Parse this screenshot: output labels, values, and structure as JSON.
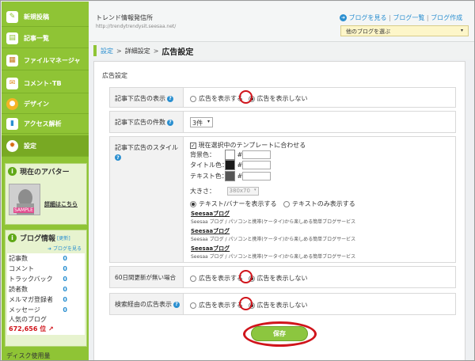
{
  "sidebar": {
    "nav": [
      {
        "label": "新規投稿",
        "icon": "pencil-icon"
      },
      {
        "label": "記事一覧",
        "icon": "document-icon"
      },
      {
        "label": "ファイルマネージャ",
        "icon": "file-icon"
      },
      {
        "label": "コメント･TB",
        "icon": "comment-icon"
      },
      {
        "label": "デザイン",
        "icon": "palette-icon"
      },
      {
        "label": "アクセス解析",
        "icon": "chart-icon"
      },
      {
        "label": "設定",
        "icon": "gear-icon"
      }
    ],
    "avatar_panel": {
      "title": "現在のアバター",
      "sample_label": "SAMPLE",
      "detail_link": "詳細はこちら"
    },
    "blog_info": {
      "title": "ブログ情報",
      "update_link": "[更新]",
      "view_blog": "ブログを見る",
      "stats": [
        {
          "label": "記事数",
          "value": "0"
        },
        {
          "label": "コメント",
          "value": "0"
        },
        {
          "label": "トラックバック",
          "value": "0"
        },
        {
          "label": "読者数",
          "value": "0"
        },
        {
          "label": "メルマガ登録者",
          "value": "0"
        },
        {
          "label": "メッセージ",
          "value": "0"
        }
      ],
      "popular_label": "人気のブログ",
      "popular_rank": "672,656 位"
    },
    "disk_usage": "ディスク使用量"
  },
  "header": {
    "blog_name": "トレンド情報発信所",
    "blog_url": "http://trendytrendysit.seesaa.net/",
    "links": {
      "view_blog": "ブログを見る",
      "blog_list": "ブログ一覧",
      "create_blog": "ブログ作成",
      "sep": "|"
    },
    "other_blog_select": "他のブログを選ぶ"
  },
  "breadcrumb": {
    "settings": "設定",
    "detail": "詳細設定",
    "current": "広告設定",
    "sep": ">"
  },
  "form": {
    "section_title": "広告設定",
    "show_ads": "広告を表示する",
    "hide_ads": "広告を表示しない",
    "rows": {
      "under_article": {
        "label": "記事下広告の表示"
      },
      "count": {
        "label": "記事下広告の件数",
        "value": "3件"
      },
      "style": {
        "label": "記事下広告のスタイル",
        "match_template": "現在選択中のテンプレートに合わせる",
        "bg_color": "背景色：",
        "title_color": "タイトル色：",
        "text_color": "テキスト色：",
        "hash": "#",
        "size_label": "大きさ：",
        "size_value": "380x70",
        "text_banner": "テキスト/バナーを表示する",
        "text_only": "テキストのみ表示する",
        "samples": [
          {
            "title": "Seesaaブログ",
            "desc": "Seesaa ブログ / パソコンと携帯(ケータイ)から楽しめる簡単ブログサービス"
          },
          {
            "title": "Seesaaブログ",
            "desc": "Seesaa ブログ / パソコンと携帯(ケータイ)から楽しめる簡単ブログサービス"
          },
          {
            "title": "Seesaaブログ",
            "desc": "Seesaa ブログ / パソコンと携帯(ケータイ)から楽しめる簡単ブログサービス"
          }
        ]
      },
      "no_update": {
        "label": "60日間更新が無い場合"
      },
      "search": {
        "label": "検索経由の広告表示"
      }
    },
    "save": "保存"
  },
  "colors": {
    "sidebar_green": "#8fc435",
    "link_blue": "#2a8fd0",
    "highlight_red": "#d0141b",
    "save_button": "#8cc63f"
  }
}
